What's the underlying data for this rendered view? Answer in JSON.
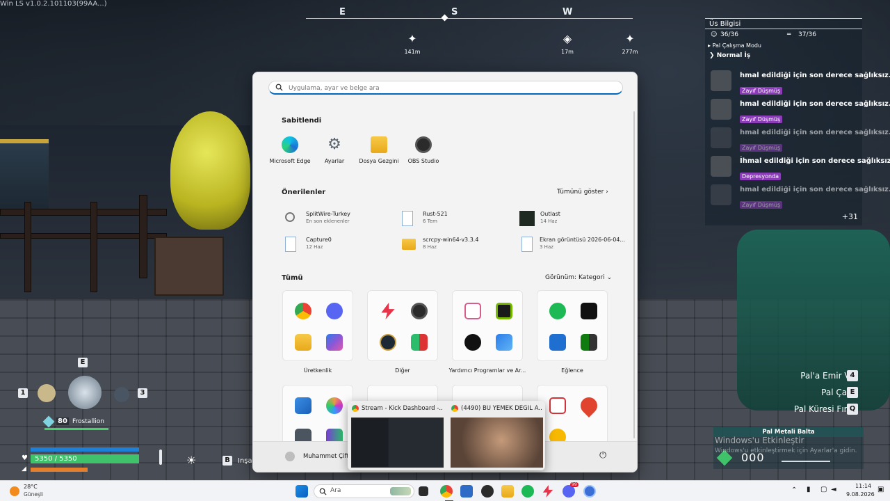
{
  "game": {
    "version": "Win LS v1.0.2.101103(99AA...)",
    "compass": {
      "directions": [
        "E",
        "S",
        "W"
      ],
      "markers": [
        {
          "icon": "pal-marker-icon",
          "distance": "141m"
        },
        {
          "icon": "base-marker-icon",
          "distance": "17m"
        },
        {
          "icon": "pal-marker-icon",
          "distance": "277m"
        }
      ]
    },
    "base_panel": {
      "title": "Üs Bilgisi",
      "pal_count": "36/36",
      "bed_count": "37/36",
      "work_mode_label": "Pal Çalışma Modu",
      "work_mode_value": "Normal İş",
      "entries": [
        {
          "text": "hmal edildiği için son derece sağlıksız.",
          "status": "Zayıf Düşmüş"
        },
        {
          "text": "hmal edildiği için son derece sağlıksız.",
          "status": "Zayıf Düşmüş"
        },
        {
          "text": "hmal edildiği için son derece sağlıksız.",
          "status": "Zayıf Düşmüş"
        },
        {
          "text": "İhmal edildiği için son derece sağlıksız",
          "status": "Depresyonda"
        },
        {
          "text": "hmal edildiği için son derece sağlıksız.",
          "status": "Zayıf Düşmüş"
        }
      ],
      "more": "+31"
    },
    "commands": [
      {
        "label": "Pal'a Emir Ver",
        "key": "4"
      },
      {
        "label": "Pal Çağır",
        "key": "E"
      },
      {
        "label": "Pal Küresi Fırlat",
        "key": "Q"
      }
    ],
    "party": {
      "key_top": "E",
      "slot_left": "1",
      "slot_right": "3",
      "level": "80",
      "pal_name": "Frostallion"
    },
    "health": "5350 / 5350",
    "build_key": "B",
    "build_label": "İnşa",
    "weapon": {
      "name": "Pal Metali Balta",
      "ammo": "000"
    },
    "activation": {
      "title": "Windows'u Etkinleştir",
      "subtitle": "Windows'u etkinleştirmek için Ayarlar'a gidin."
    }
  },
  "start_menu": {
    "search_placeholder": "Uygulama, ayar ve belge ara",
    "pinned_title": "Sabitlendi",
    "pinned": [
      {
        "label": "Microsoft Edge",
        "icon": "edge-icon"
      },
      {
        "label": "Ayarlar",
        "icon": "settings-gear-icon"
      },
      {
        "label": "Dosya Gezgini",
        "icon": "folder-icon"
      },
      {
        "label": "OBS Studio",
        "icon": "obs-icon"
      }
    ],
    "recommended_title": "Önerilenler",
    "show_all": "Tümünü göster",
    "recommended": [
      {
        "title": "SplitWire-Turkey",
        "sub": "En son eklenenler",
        "icon": "splitwire-icon"
      },
      {
        "title": "Rust-521",
        "sub": "6 Tem",
        "icon": "file-icon"
      },
      {
        "title": "Outlast",
        "sub": "14 Haz",
        "icon": "outlast-icon"
      },
      {
        "title": "Capture0",
        "sub": "12 Haz",
        "icon": "file-icon"
      },
      {
        "title": "scrcpy-win64-v3.3.4",
        "sub": "8 Haz",
        "icon": "folder-icon"
      },
      {
        "title": "Ekran görüntüsü 2026-06-04...",
        "sub": "3 Haz",
        "icon": "file-icon"
      }
    ],
    "all_title": "Tümü",
    "view_label": "Görünüm: Kategori",
    "categories": [
      {
        "label": "Üretkenlik"
      },
      {
        "label": "Diğer"
      },
      {
        "label": "Yardımcı Programlar ve Ar..."
      },
      {
        "label": "Eğlence"
      }
    ],
    "user_name": "Muhammet Çiftci",
    "colors": {
      "accent": "#0067c0",
      "background": "#f3f3f3"
    }
  },
  "thumbnails": [
    {
      "caption": "Stream - Kick Dashboard -..."
    },
    {
      "caption": "(4490) BU YEMEK DEĞİL A..."
    }
  ],
  "taskbar": {
    "weather_temp": "28°C",
    "weather_desc": "Güneşli",
    "search_label": "Ara",
    "time": "11:14",
    "date": "9.08.2026",
    "notif_badge": "99"
  }
}
